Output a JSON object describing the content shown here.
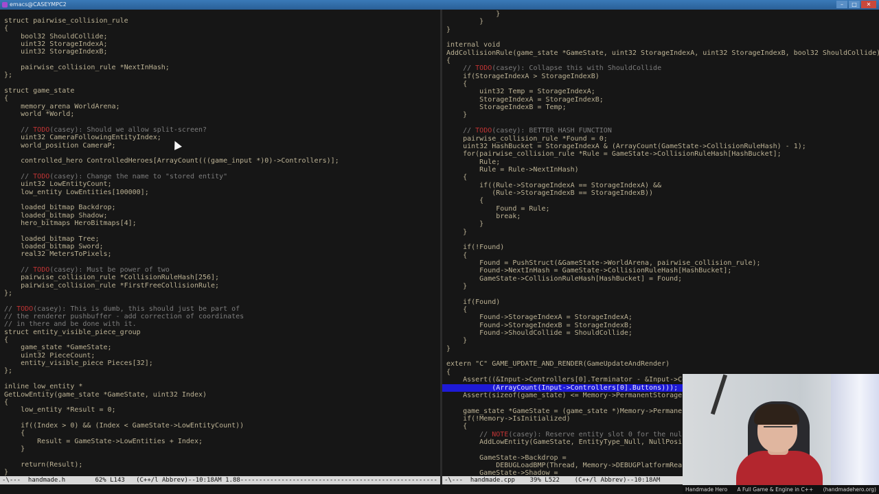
{
  "window": {
    "title": "emacs@CASEYMPC2",
    "controls": [
      "–",
      "□",
      "✕"
    ]
  },
  "left_pane": {
    "lines": [
      {
        "text": "struct pairwise_collision_rule"
      },
      {
        "text": "{"
      },
      {
        "text": "    bool32 ShouldCollide;"
      },
      {
        "text": "    uint32 StorageIndexA;"
      },
      {
        "text": "    uint32 StorageIndexB;"
      },
      {
        "text": ""
      },
      {
        "text": "    pairwise_collision_rule *NextInHash;"
      },
      {
        "text": "};"
      },
      {
        "text": ""
      },
      {
        "text": "struct game_state"
      },
      {
        "text": "{"
      },
      {
        "text": "    memory_arena WorldArena;"
      },
      {
        "text": "    world *World;"
      },
      {
        "text": ""
      },
      {
        "text": "    // TODO(casey): Should we allow split-screen?",
        "kind": "comment"
      },
      {
        "text": "    uint32 CameraFollowingEntityIndex;"
      },
      {
        "text": "    world_position CameraP;"
      },
      {
        "text": ""
      },
      {
        "text": "    controlled_hero ControlledHeroes[ArrayCount(((game_input *)0)->Controllers)];"
      },
      {
        "text": ""
      },
      {
        "text": "    // TODO(casey): Change the name to \"stored entity\"",
        "kind": "comment"
      },
      {
        "text": "    uint32 LowEntityCount;"
      },
      {
        "text": "    low_entity LowEntities[100000];"
      },
      {
        "text": ""
      },
      {
        "text": "    loaded_bitmap Backdrop;"
      },
      {
        "text": "    loaded_bitmap Shadow;"
      },
      {
        "text": "    hero_bitmaps HeroBitmaps[4];"
      },
      {
        "text": ""
      },
      {
        "text": "    loaded_bitmap Tree;"
      },
      {
        "text": "    loaded_bitmap Sword;"
      },
      {
        "text": "    real32 MetersToPixels;"
      },
      {
        "text": ""
      },
      {
        "text": "    // TODO(casey): Must be power of two",
        "kind": "comment"
      },
      {
        "text": "    pairwise_collision_rule *CollisionRuleHash[256];"
      },
      {
        "text": "    pairwise_collision_rule *FirstFreeCollisionRule;"
      },
      {
        "text": "};"
      },
      {
        "text": ""
      },
      {
        "text": "// TODO(casey): This is dumb, this should just be part of",
        "kind": "comment"
      },
      {
        "text": "// the renderer pushbuffer - add correction of coordinates",
        "kind": "comment"
      },
      {
        "text": "// in there and be done with it.",
        "kind": "comment"
      },
      {
        "text": "struct entity_visible_piece_group"
      },
      {
        "text": "{"
      },
      {
        "text": "    game_state *GameState;"
      },
      {
        "text": "    uint32 PieceCount;"
      },
      {
        "text": "    entity_visible_piece Pieces[32];"
      },
      {
        "text": "};"
      },
      {
        "text": ""
      },
      {
        "text": "inline low_entity *"
      },
      {
        "text": "GetLowEntity(game_state *GameState, uint32 Index)"
      },
      {
        "text": "{"
      },
      {
        "text": "    low_entity *Result = 0;"
      },
      {
        "text": ""
      },
      {
        "text": "    if((Index > 0) && (Index < GameState->LowEntityCount))"
      },
      {
        "text": "    {"
      },
      {
        "text": "        Result = GameState->LowEntities + Index;"
      },
      {
        "text": "    }"
      },
      {
        "text": ""
      },
      {
        "text": "    return(Result);"
      },
      {
        "text": "}"
      }
    ]
  },
  "right_pane": {
    "lines": [
      {
        "text": "            }"
      },
      {
        "text": "        }"
      },
      {
        "text": "}"
      },
      {
        "text": ""
      },
      {
        "text": "internal void"
      },
      {
        "text": "AddCollisionRule(game_state *GameState, uint32 StorageIndexA, uint32 StorageIndexB, bool32 ShouldCollide)"
      },
      {
        "text": "{"
      },
      {
        "text": "    // TODO(casey): Collapse this with ShouldCollide",
        "kind": "comment"
      },
      {
        "text": "    if(StorageIndexA > StorageIndexB)"
      },
      {
        "text": "    {"
      },
      {
        "text": "        uint32 Temp = StorageIndexA;"
      },
      {
        "text": "        StorageIndexA = StorageIndexB;"
      },
      {
        "text": "        StorageIndexB = Temp;"
      },
      {
        "text": "    }"
      },
      {
        "text": ""
      },
      {
        "text": "    // TODO(casey): BETTER HASH FUNCTION",
        "kind": "comment"
      },
      {
        "text": "    pairwise_collision_rule *Found = 0;"
      },
      {
        "text": "    uint32 HashBucket = StorageIndexA & (ArrayCount(GameState->CollisionRuleHash) - 1);"
      },
      {
        "text": "    for(pairwise_collision_rule *Rule = GameState->CollisionRuleHash[HashBucket];"
      },
      {
        "text": "        Rule;"
      },
      {
        "text": "        Rule = Rule->NextInHash)"
      },
      {
        "text": "    {"
      },
      {
        "text": "        if((Rule->StorageIndexA == StorageIndexA) &&"
      },
      {
        "text": "           (Rule->StorageIndexB == StorageIndexB))"
      },
      {
        "text": "        {"
      },
      {
        "text": "            Found = Rule;"
      },
      {
        "text": "            break;"
      },
      {
        "text": "        }"
      },
      {
        "text": "    }"
      },
      {
        "text": ""
      },
      {
        "text": "    if(!Found)"
      },
      {
        "text": "    {"
      },
      {
        "text": "        Found = PushStruct(&GameState->WorldArena, pairwise_collision_rule);"
      },
      {
        "text": "        Found->NextInHash = GameState->CollisionRuleHash[HashBucket];"
      },
      {
        "text": "        GameState->CollisionRuleHash[HashBucket] = Found;"
      },
      {
        "text": "    }"
      },
      {
        "text": ""
      },
      {
        "text": "    if(Found)"
      },
      {
        "text": "    {"
      },
      {
        "text": "        Found->StorageIndexA = StorageIndexA;"
      },
      {
        "text": "        Found->StorageIndexB = StorageIndexB;"
      },
      {
        "text": "        Found->ShouldCollide = ShouldCollide;"
      },
      {
        "text": "    }"
      },
      {
        "text": "}"
      },
      {
        "text": ""
      },
      {
        "text": "extern \"C\" GAME_UPDATE_AND_RENDER(GameUpdateAndRender)"
      },
      {
        "text": "{"
      },
      {
        "text": "    Assert((&Input->Controllers[0].Terminator - &Input->Co"
      },
      {
        "text": "           (ArrayCount(Input->Controllers[0].Buttons)));",
        "kind": "selected"
      },
      {
        "text": "    Assert(sizeof(game_state) <= Memory->PermanentStorage"
      },
      {
        "text": ""
      },
      {
        "text": "    game_state *GameState = (game_state *)Memory->Permanen"
      },
      {
        "text": "    if(!Memory->IsInitialized)"
      },
      {
        "text": "    {"
      },
      {
        "text": "        // NOTE(casey): Reserve entity slot 0 for the nul",
        "kind": "comment"
      },
      {
        "text": "        AddLowEntity(GameState, EntityType_Null, NullPosi"
      },
      {
        "text": ""
      },
      {
        "text": "        GameState->Backdrop ="
      },
      {
        "text": "            DEBUGLoadBMP(Thread, Memory->DEBUGPlatformRea"
      },
      {
        "text": "        GameState->Shadow ="
      }
    ]
  },
  "left_modeline": {
    "text": "-\\---  handmade.h        62% L143   (C++/l Abbrev)--10:18AM 1.88-----------------------------------------------------"
  },
  "right_modeline": {
    "text": "-\\---  handmade.cpp    39% L522    (C++/l Abbrev)--10:18AM"
  },
  "webcam": {
    "caption_left": "Handmade Hero",
    "caption_center": "A Full Game & Engine in C++",
    "caption_right": "(handmadehero.org)"
  },
  "colors": {
    "background": "#161616",
    "code_text": "#bdb395",
    "comment": "#7d7d7d",
    "todo": "#c03434",
    "selection": "#1e1ad6",
    "cursor": "#41b24b",
    "modeline": "#d9d9d9"
  }
}
